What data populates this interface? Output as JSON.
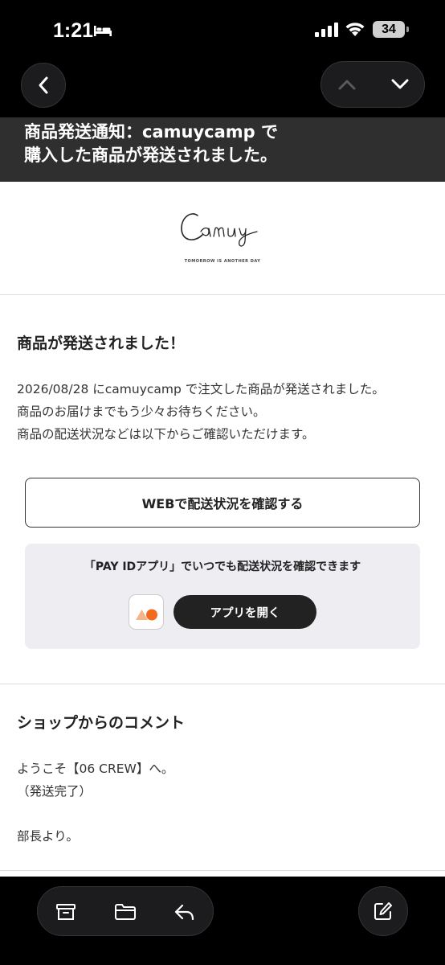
{
  "status_bar": {
    "time": "1:21",
    "battery": "34"
  },
  "subject": {
    "line1": "商品発送通知：camuycamp で",
    "line2": "購入した商品が発送されました。"
  },
  "logo": {
    "tagline": "TOMORROW IS ANOTHER DAY"
  },
  "shipment": {
    "heading": "商品が発送されました！",
    "lines": [
      "2026/08/28 にcamuycamp で注文した商品が発送されました。",
      "商品のお届けまでもう少々お待ちください。",
      "商品の配送状況などは以下からご確認いただけます。"
    ],
    "web_button_label": "WEBで配送状況を確認する"
  },
  "app_card": {
    "promo": "「PAY IDアプリ」でいつでも配送状況を確認できます",
    "open_button_label": "アプリを開く",
    "icon_colors": {
      "triangle": "#f5b58a",
      "circle": "#f26b1d"
    }
  },
  "comment": {
    "heading": "ショップからのコメント",
    "lines": [
      "ようこそ【06 CREW】へ。",
      "（発送完了）",
      "",
      "部長より。"
    ]
  },
  "toolbar": {
    "icons": [
      "archive-icon",
      "folder-icon",
      "reply-icon",
      "compose-icon"
    ]
  }
}
